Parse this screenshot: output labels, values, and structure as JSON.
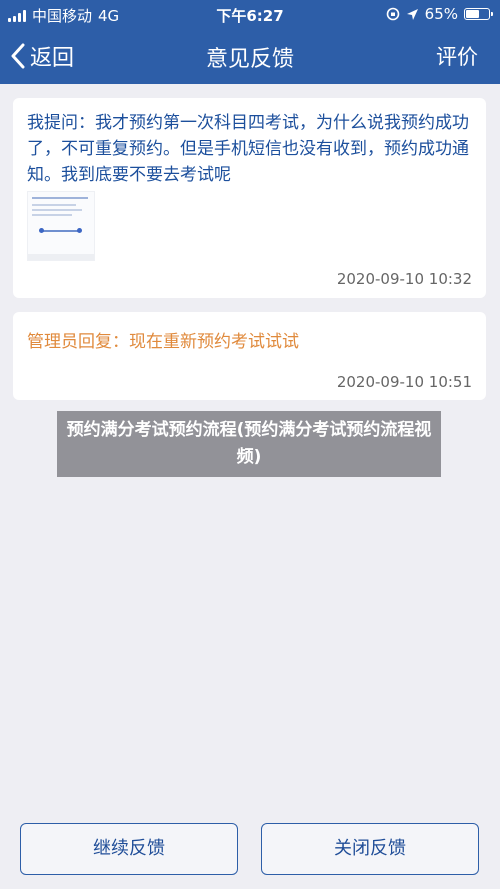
{
  "status_bar": {
    "carrier": "中国移动",
    "network": "4G",
    "time": "下午6:27",
    "battery": "65%",
    "battery_level": 0.65
  },
  "nav": {
    "back_label": "返回",
    "title": "意见反馈",
    "rate_label": "评价"
  },
  "question": {
    "text": "我提问：我才预约第一次科目四考试，为什么说我预约成功了，不可重复预约。但是手机短信也没有收到，预约成功通知。我到底要不要去考试呢",
    "timestamp": "2020-09-10 10:32"
  },
  "reply": {
    "text": "管理员回复：现在重新预约考试试试",
    "timestamp": "2020-09-10 10:51"
  },
  "overlay_caption": "预约满分考试预约流程(预约满分考试预约流程视频)",
  "buttons": {
    "continue_label": "继续反馈",
    "close_label": "关闭反馈"
  },
  "colors": {
    "brand_blue": "#2d5ea8",
    "question_text": "#1c4f9c",
    "reply_text": "#e08a3c"
  }
}
